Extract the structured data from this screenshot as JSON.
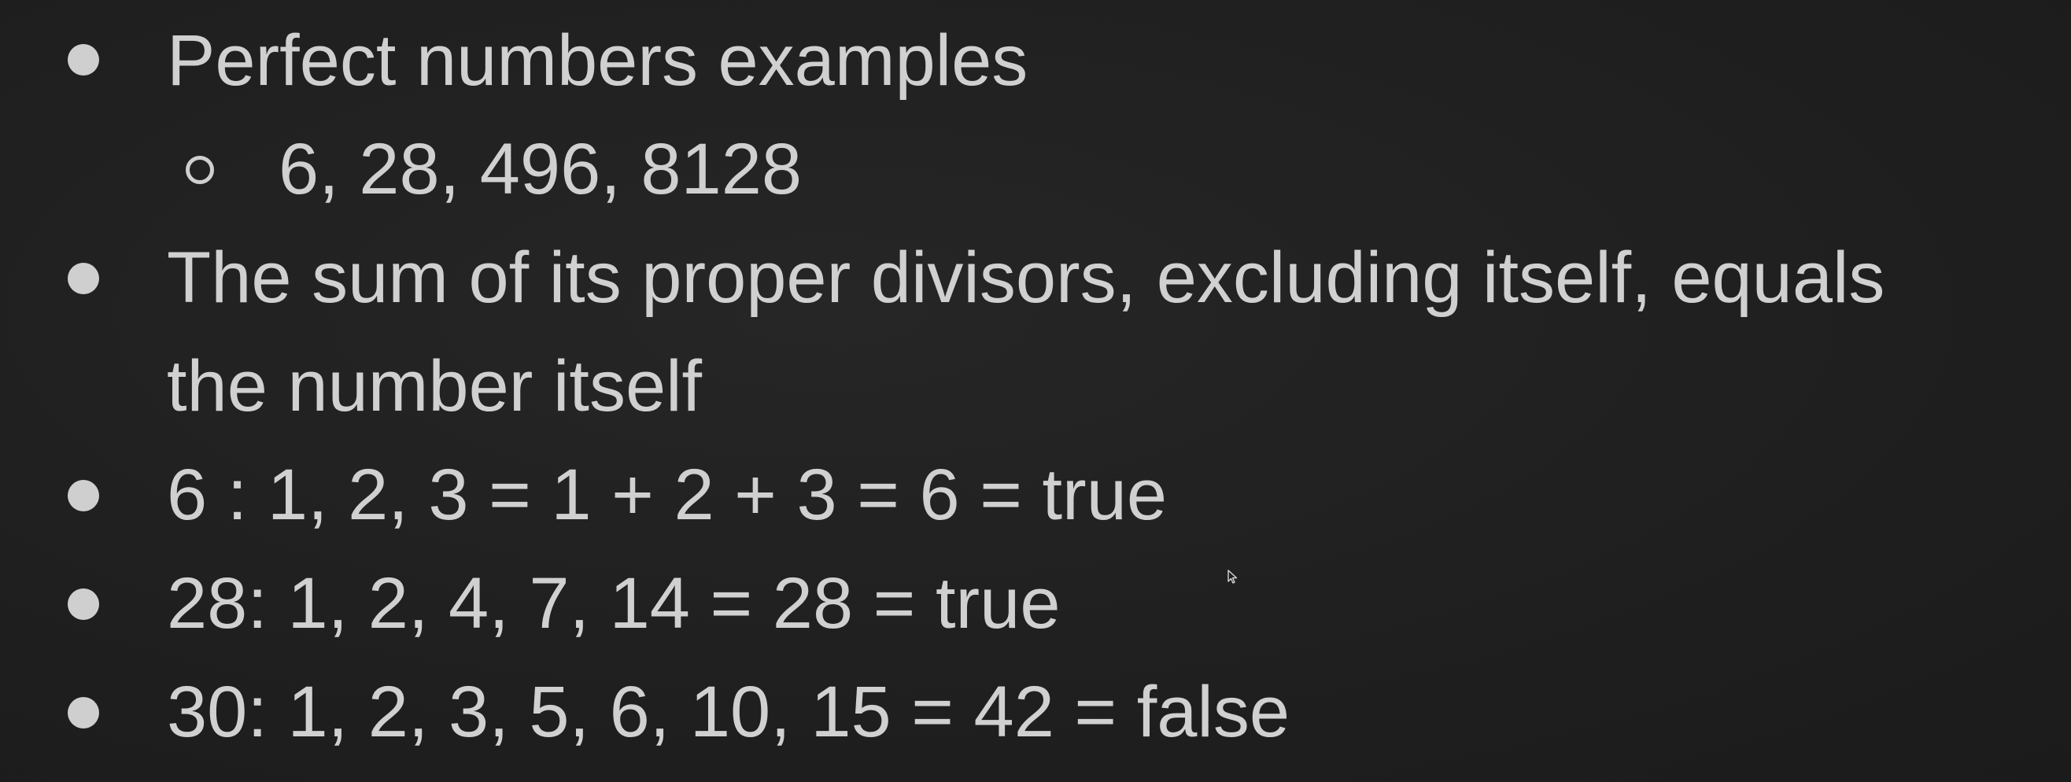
{
  "slide": {
    "bullets": [
      {
        "text": "Perfect numbers examples"
      },
      {
        "text": "6, 28, 496, 8128",
        "level": 2
      },
      {
        "text": "The sum of its proper divisors, excluding itself, equals"
      },
      {
        "text": "the number itself",
        "continuation": true
      },
      {
        "text": "6 : 1, 2, 3 = 1 + 2 + 3 = 6 = true"
      },
      {
        "text": "28: 1, 2, 4, 7, 14 = 28 = true"
      },
      {
        "text": "30: 1, 2,  3, 5, 6, 10, 15 = 42 = false"
      }
    ]
  },
  "colors": {
    "background": "#1f1f1f",
    "text": "#d0d0d0",
    "bullet": "#cfcfcf"
  },
  "icons": {
    "bullet_level1": "filled-circle",
    "bullet_level2": "hollow-circle",
    "cursor": "mouse-pointer-icon"
  }
}
